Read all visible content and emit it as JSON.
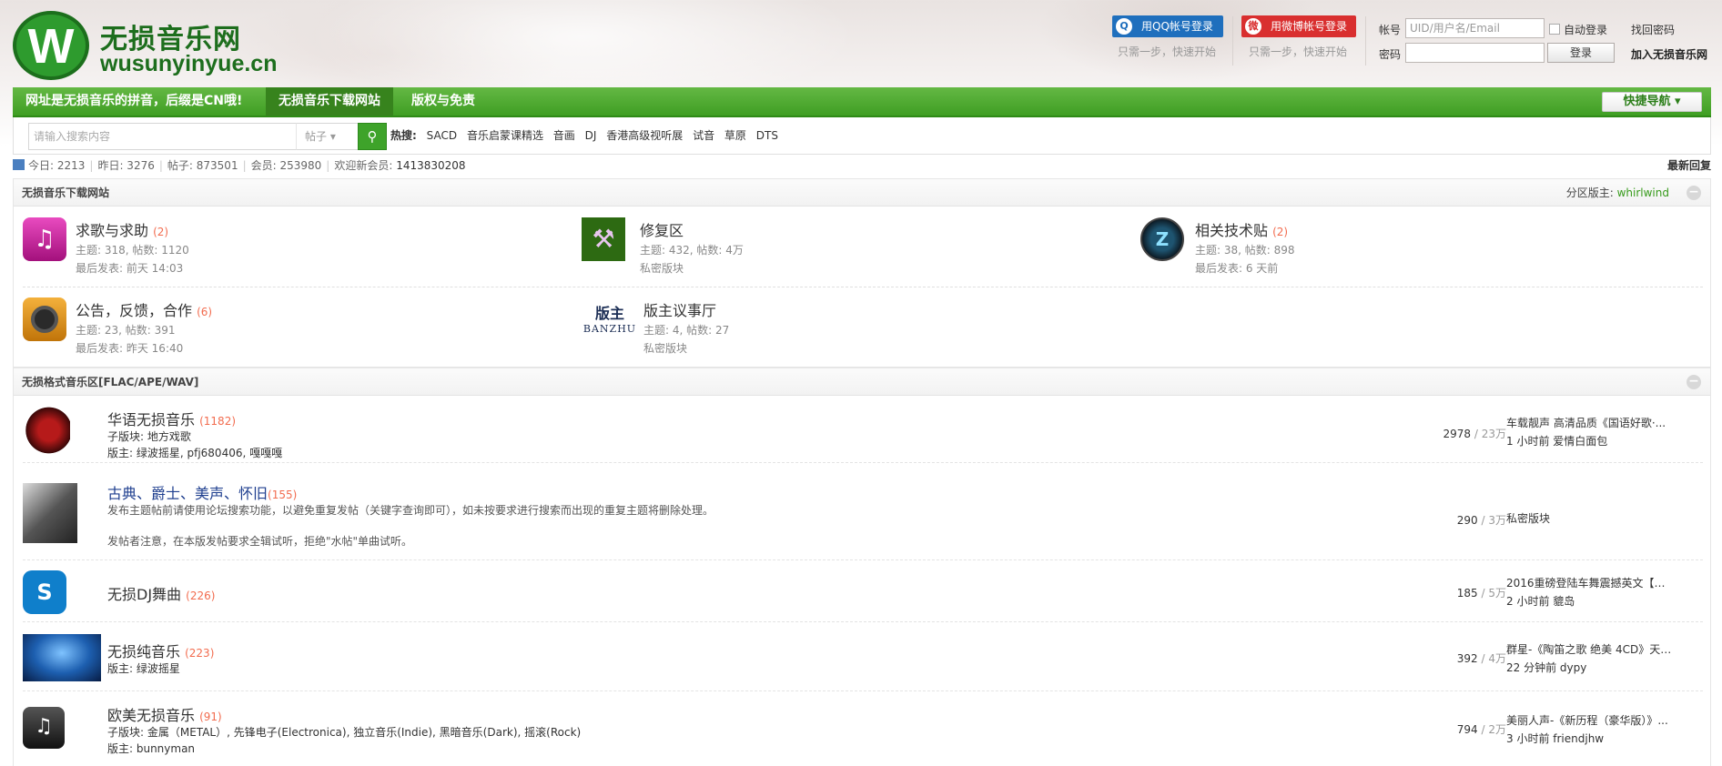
{
  "logo": {
    "title": "无损音乐网",
    "domain": "wusunyinyue.cn",
    "mark": "W"
  },
  "social": {
    "qq_label": "用QQ帐号登录",
    "qq_tip": "只需一步，快速开始",
    "weibo_label": "用微博帐号登录",
    "weibo_tip": "只需一步，快速开始"
  },
  "login": {
    "account_label": "帐号",
    "account_placeholder": "UID/用户名/Email",
    "auto_login": "自动登录",
    "find_password": "找回密码",
    "password_label": "密码",
    "login_button": "登录",
    "join": "加入无损音乐网"
  },
  "nav": {
    "items": [
      "网址是无损音乐的拼音，后缀是CN哦!",
      "无损音乐下载网站",
      "版权与免责"
    ],
    "active_index": 1,
    "quick_nav": "快捷导航 ▾"
  },
  "search": {
    "placeholder": "请输入搜索内容",
    "type": "帖子 ▾",
    "hot_label": "热搜:",
    "hot_words": [
      "SACD",
      "音乐启蒙课精选",
      "音画",
      "DJ",
      "香港高级视听展",
      "试音",
      "草原",
      "DTS"
    ]
  },
  "stats": {
    "today": "今日: 2213",
    "yesterday": "昨日: 3276",
    "posts": "帖子: 873501",
    "members": "会员: 253980",
    "welcome": "欢迎新会员:",
    "new_member": "1413830208",
    "latest_reply": "最新回复"
  },
  "section1": {
    "title": "无损音乐下载网站",
    "moderator_label": "分区版主:",
    "moderator": "whirlwind",
    "forums": [
      {
        "name": "求歌与求助",
        "count": "(2)",
        "meta1": "主题: 318, 帖数: 1120",
        "meta2": "最后发表: 前天 14:03"
      },
      {
        "name": "修复区",
        "count": "",
        "meta1": "主题: 432, 帖数: 4万",
        "meta2": "私密版块"
      },
      {
        "name": "相关技术贴",
        "count": "(2)",
        "meta1": "主题: 38, 帖数: 898",
        "meta2": "最后发表: 6 天前"
      },
      {
        "name": "公告，反馈，合作",
        "count": "(6)",
        "meta1": "主题: 23, 帖数: 391",
        "meta2": "最后发表: 昨天 16:40"
      },
      {
        "name": "版主议事厅",
        "count": "",
        "meta1": "主题: 4, 帖数: 27",
        "meta2": "私密版块"
      }
    ],
    "banzhu_text": "版主",
    "banzhu_sub": "BANZHU"
  },
  "section2": {
    "title": "无损格式音乐区[FLAC/APE/WAV]",
    "forums": [
      {
        "name": "华语无损音乐",
        "count": "(1182)",
        "line1": "子版块: 地方戏歌",
        "line2": "版主: 绿波摇星, pfj680406, 嘎嘎嘎",
        "stats_a": "2978",
        "stats_b": " / 23万",
        "last_title": "车载靓声 高清品质《国语好歌·...",
        "last_meta": "1 小时前 爱情白面包"
      },
      {
        "name": "古典、爵士、美声、怀旧",
        "count": "(155)",
        "line1": "发布主题帖前请使用论坛搜索功能，以避免重复发帖（关键字查询即可），如未按要求进行搜索而出现的重复主题将删除处理。",
        "line2": "发帖者注意，在本版发帖要求全辑试听，拒绝\"水帖\"单曲试听。",
        "stats_a": "290",
        "stats_b": " / 3万",
        "last_title": "私密版块",
        "last_meta": ""
      },
      {
        "name": "无损DJ舞曲",
        "count": "(226)",
        "line1": "",
        "line2": "",
        "stats_a": "185",
        "stats_b": " / 5万",
        "last_title": "2016重磅登陆车舞震撼英文【车舞...",
        "last_meta": "2 小时前 貔岛"
      },
      {
        "name": "无损纯音乐",
        "count": "(223)",
        "line1": "版主: 绿波摇星",
        "line2": "",
        "stats_a": "392",
        "stats_b": " / 4万",
        "last_title": "群星-《陶笛之歌 绝美 4CD》天籁...",
        "last_meta": "22 分钟前 dypy"
      },
      {
        "name": "欧美无损音乐",
        "count": "(91)",
        "line1": "子版块: 金属（METAL）, 先锋电子(Electronica), 独立音乐(Indie), 黑暗音乐(Dark), 摇滚(Rock)",
        "line2": "版主: bunnyman",
        "stats_a": "794",
        "stats_b": " / 2万",
        "last_title": "美丽人声-《新历程（豪华版）》...",
        "last_meta": "3 小时前 friendjhw"
      }
    ]
  },
  "colors": {
    "brand_green": "#3f9e23",
    "count_orange": "#f26c4f",
    "classic_blue": "#1f3f8f"
  }
}
